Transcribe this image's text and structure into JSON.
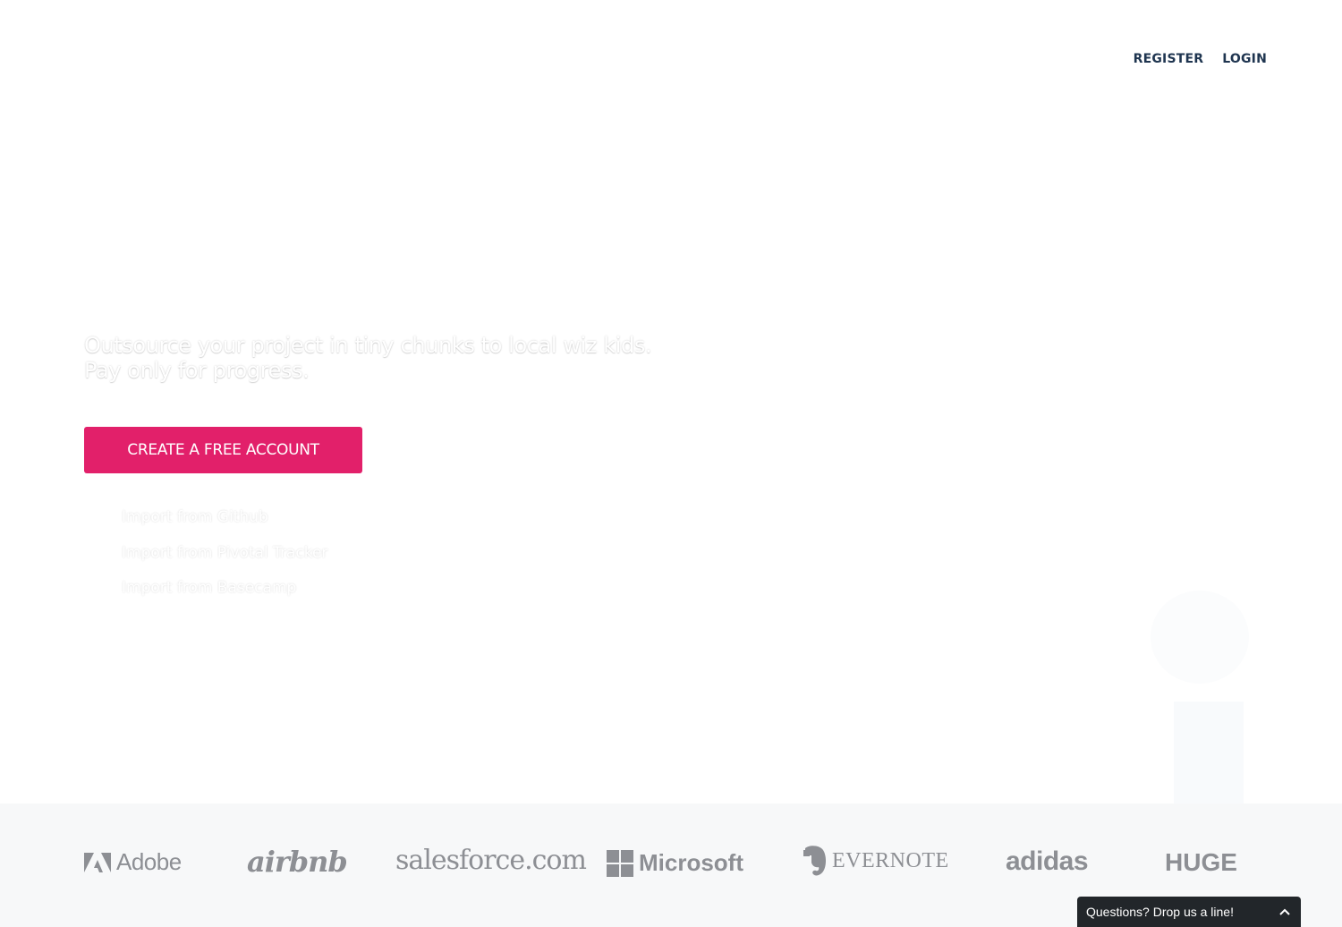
{
  "nav": {
    "register_label": "REGISTER",
    "login_label": "LOGIN"
  },
  "hero": {
    "line1": "Outsource your project in tiny chunks to local wiz kids.",
    "line2": "Pay only for progress.",
    "cta_label": "CREATE A FREE ACCOUNT",
    "cta_color": "#e2206a"
  },
  "imports": [
    {
      "label": "Import from Github"
    },
    {
      "label": "Import from Pivotal Tracker"
    },
    {
      "label": "Import from Basecamp"
    }
  ],
  "logos": {
    "adobe": "Adobe",
    "airbnb": "airbnb",
    "salesforce": "salesforce.com",
    "microsoft": "Microsoft",
    "evernote": "EVERNOTE",
    "adidas": "adidas",
    "huge": "HUGE"
  },
  "chat": {
    "label": "Questions? Drop us a line!",
    "icon": "chevron-up-icon"
  }
}
